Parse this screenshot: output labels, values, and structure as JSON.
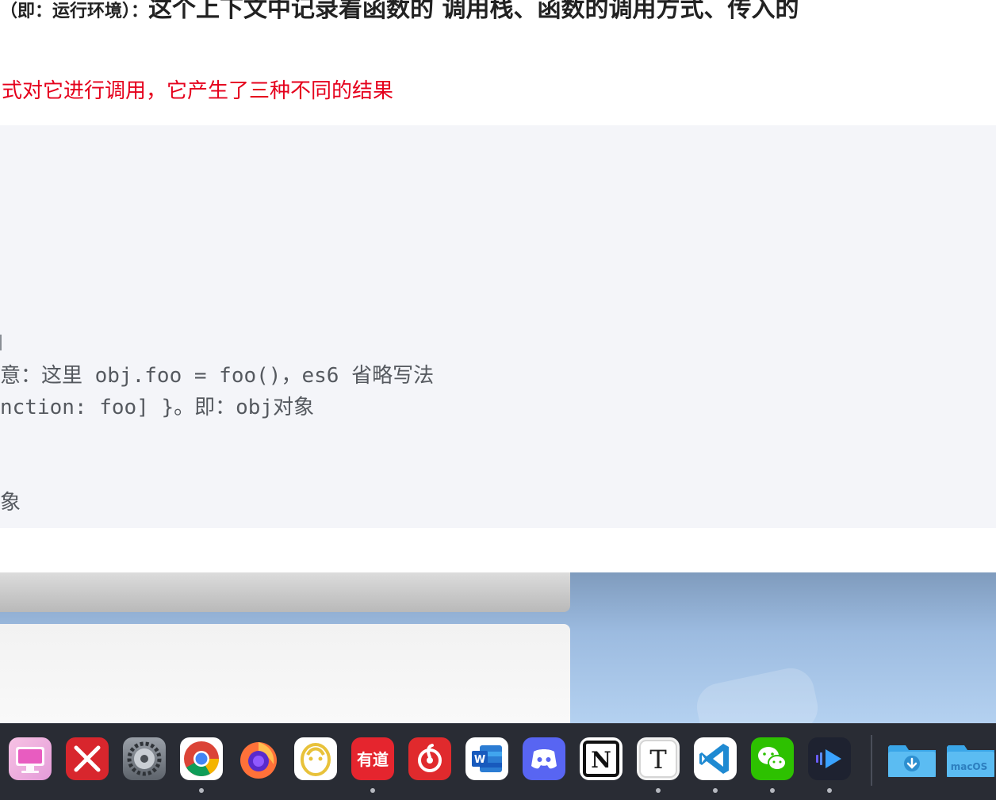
{
  "document": {
    "heading_part1": "（即：运行环境）：",
    "heading_part2": "这个上下文中记录着函数的 调用栈、函数的调用方式、传入的",
    "red_line": "式对它进行调用，它产生了三种不同的结果",
    "code_lines": [
      "意：这里 obj.foo = foo()，es6 省略写法",
      "nction: foo] }。即：obj对象",
      "象"
    ]
  },
  "dock": {
    "apps": [
      {
        "name": "cleanmymac",
        "running": false
      },
      {
        "name": "xmind",
        "running": false
      },
      {
        "name": "system-settings",
        "running": false
      },
      {
        "name": "chrome",
        "running": true
      },
      {
        "name": "firefox",
        "running": false
      },
      {
        "name": "navicat",
        "running": false
      },
      {
        "name": "youdao",
        "label": "有道",
        "running": true
      },
      {
        "name": "netease-music",
        "running": false
      },
      {
        "name": "word",
        "label": "W",
        "running": false
      },
      {
        "name": "discord",
        "running": false
      },
      {
        "name": "notion",
        "label": "N",
        "running": false
      },
      {
        "name": "typora",
        "label": "T",
        "running": true
      },
      {
        "name": "vscode",
        "running": true
      },
      {
        "name": "wechat",
        "running": true
      },
      {
        "name": "infuse",
        "running": true
      }
    ],
    "downloads_folder": {
      "name": "downloads-folder"
    },
    "macos_folder": {
      "name": "macos-folder",
      "label": "macOS"
    }
  },
  "colors": {
    "red_text": "#e5001c",
    "code_bg": "#f4f5f9",
    "dock_bg": "#20232c"
  }
}
